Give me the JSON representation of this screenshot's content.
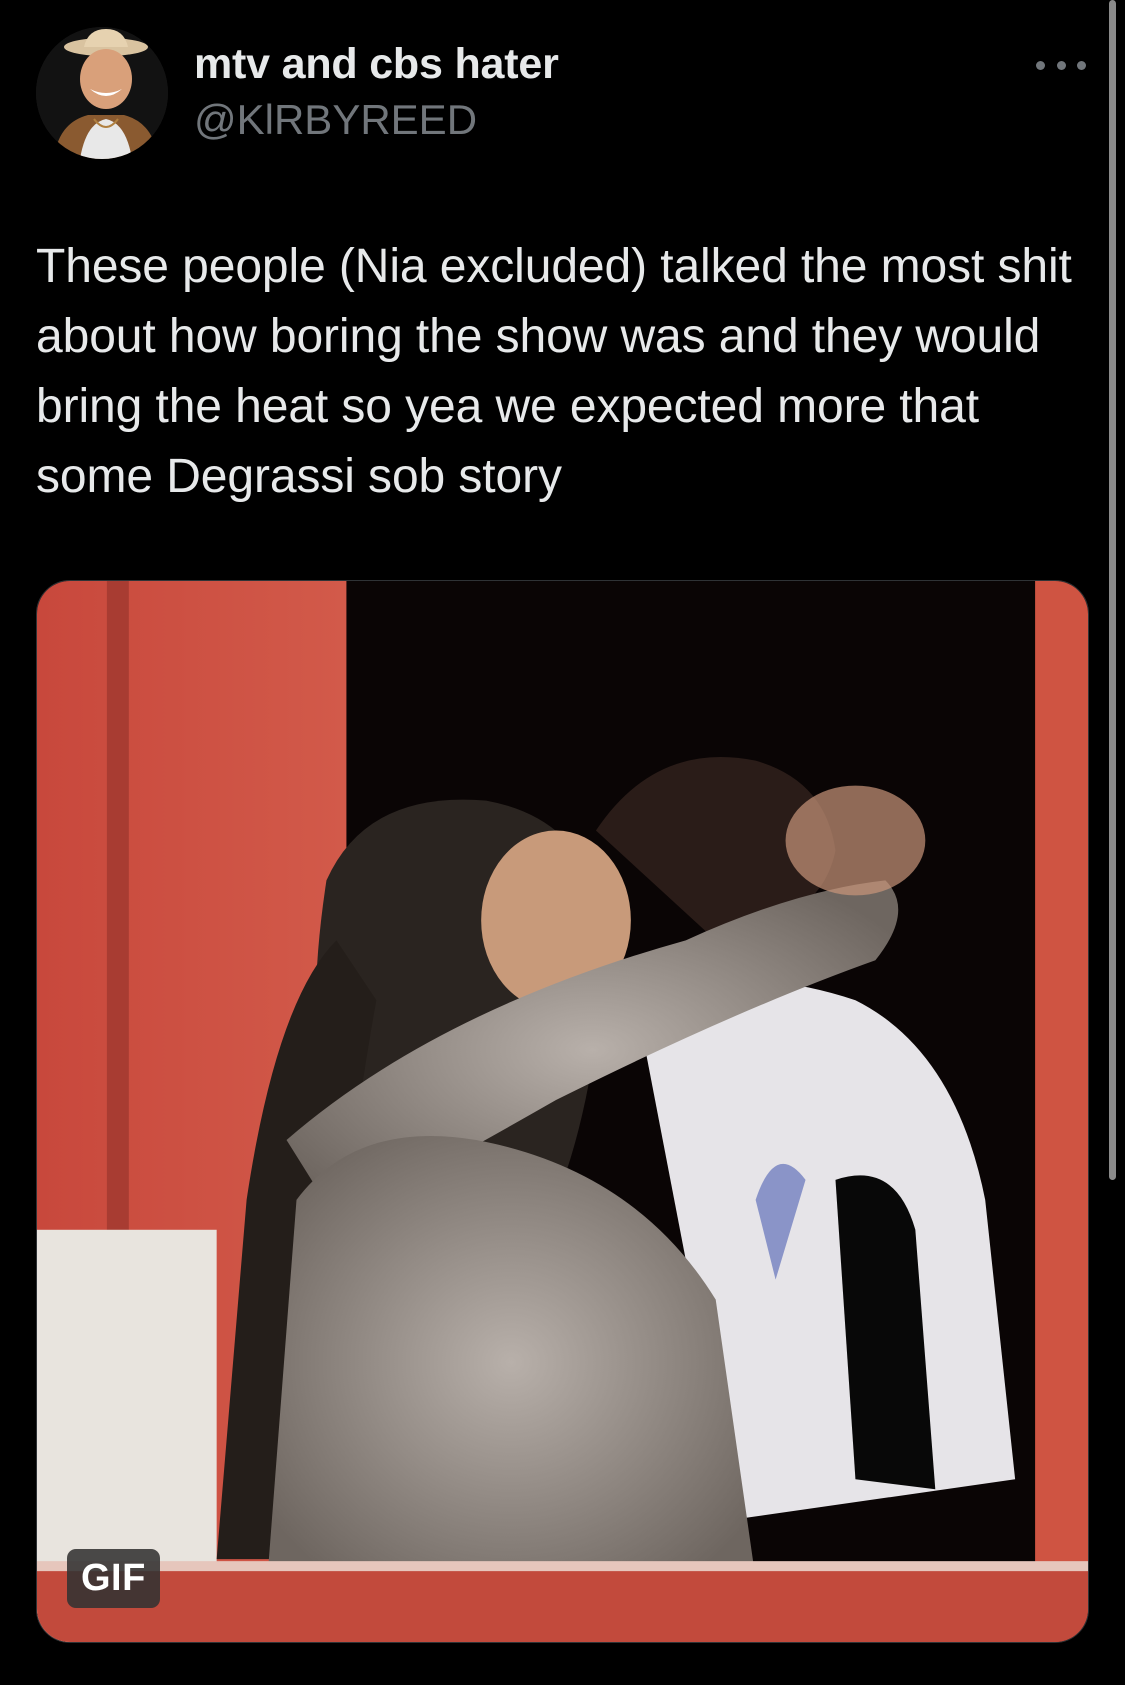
{
  "tweet": {
    "display_name": "mtv and cbs hater",
    "handle": "@KlRBYREED",
    "text": "These people (Nia excluded) talked the most shit about how boring the show was and they would bring the heat so yea we expected more that some Degrassi sob story",
    "media_badge": "GIF"
  },
  "icons": {
    "more": "more-horizontal-icon"
  },
  "colors": {
    "background": "#000000",
    "primary_text": "#e7e9ea",
    "secondary_text": "#71767b"
  }
}
